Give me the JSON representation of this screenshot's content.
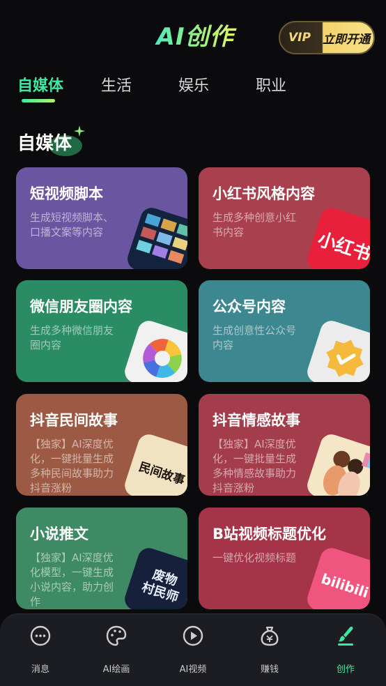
{
  "header": {
    "title": "AI创作",
    "vip_badge": "VIP",
    "vip_label": "立即开通"
  },
  "tabs": [
    {
      "label": "自媒体",
      "active": true
    },
    {
      "label": "生活",
      "active": false
    },
    {
      "label": "娱乐",
      "active": false
    },
    {
      "label": "职业",
      "active": false
    }
  ],
  "section": {
    "title": "自媒体"
  },
  "cards": [
    {
      "title": "短视频脚本",
      "desc": "生成短视频脚本、口播文案等内容",
      "color": "#6a55a0",
      "icon": "film-strip-icon"
    },
    {
      "title": "小红书风格内容",
      "desc": "生成多种创意小红书内容",
      "color": "#a8414d",
      "icon": "xiaohongshu-logo-icon",
      "thumb_text": "小红书"
    },
    {
      "title": "微信朋友圈内容",
      "desc": "生成多种微信朋友圈内容",
      "color": "#2a8c64",
      "icon": "camera-aperture-icon"
    },
    {
      "title": "公众号内容",
      "desc": "生成创意性公众号内容",
      "color": "#3d8790",
      "icon": "verified-badge-icon"
    },
    {
      "title": "抖音民间故事",
      "desc": "【独家】AI深度优化，一键批量生成多种民间故事助力抖音涨粉",
      "color": "#9c5a44",
      "icon": "folk-tale-calligraphy-icon",
      "thumb_text": "民间故事"
    },
    {
      "title": "抖音情感故事",
      "desc": "【独家】AI深度优化，一键批量生成多种情感故事助力抖音涨粉",
      "color": "#a33d4c",
      "icon": "couple-illustration-icon"
    },
    {
      "title": "小说推文",
      "desc": "【独家】AI深度优化模型，一键生成小说内容，助力创作",
      "color": "#3e8a64",
      "icon": "novel-cover-icon",
      "thumb_text": "废物 村民师"
    },
    {
      "title": "B站视频标题优化",
      "desc": "一键优化视频标题",
      "color": "#a63448",
      "icon": "bilibili-logo-icon",
      "thumb_text": "bilibili"
    }
  ],
  "nav": [
    {
      "label": "消息",
      "icon": "chat-bubble-icon",
      "active": false
    },
    {
      "label": "AI绘画",
      "icon": "palette-icon",
      "active": false
    },
    {
      "label": "AI视频",
      "icon": "play-circle-icon",
      "active": false
    },
    {
      "label": "赚钱",
      "icon": "money-bag-icon",
      "active": false
    },
    {
      "label": "创作",
      "icon": "brush-icon",
      "active": true
    }
  ],
  "colors": {
    "accent": "#3fe8a0",
    "background": "#0b0b0d",
    "nav_background": "#1c1d22"
  }
}
